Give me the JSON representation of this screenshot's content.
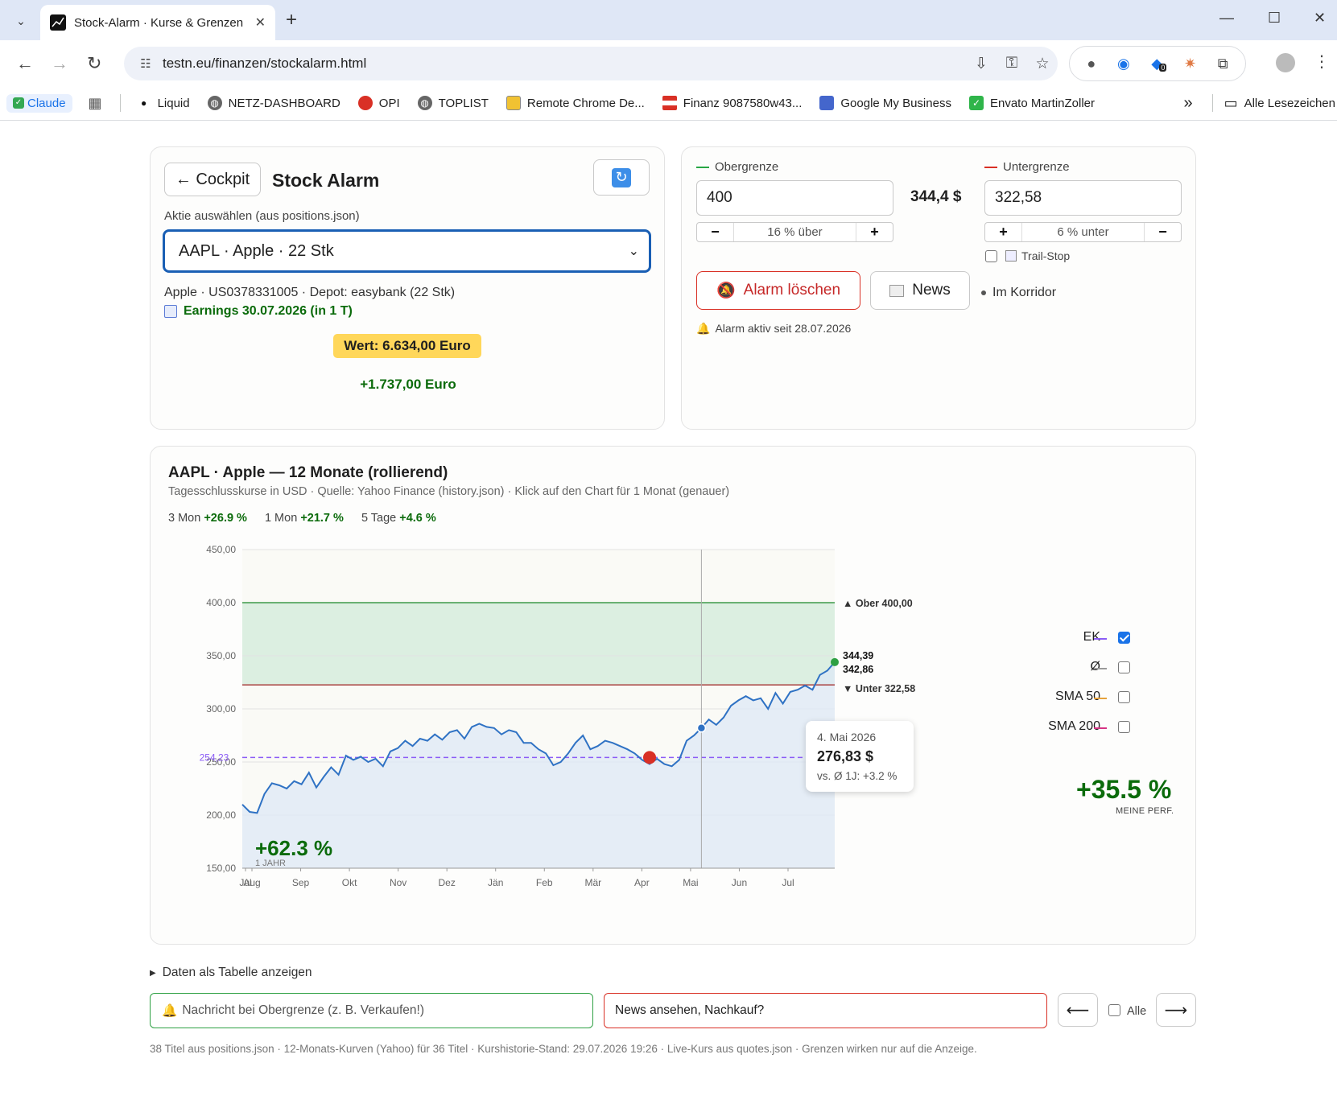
{
  "browser": {
    "tab_title": "Stock-Alarm · Kurse & Grenzen",
    "url": "testn.eu/finanzen/stockalarm.html",
    "extension_badge": "0",
    "bookmarks": [
      "Claude",
      "Liquid",
      "NETZ-DASHBOARD",
      "OPI",
      "TOPLIST",
      "Remote Chrome De...",
      "Finanz 9087580w43...",
      "Google My Business",
      "Envato MartinZoller"
    ],
    "bookmarks_more": "»",
    "all_bookmarks": "Alle Lesezeichen"
  },
  "left_card": {
    "back_label": "← Cockpit",
    "title": "Stock Alarm",
    "select_label": "Aktie auswählen (aus positions.json)",
    "select_value": "AAPL · Apple · 22 Stk",
    "info": "Apple · US0378331005 · Depot: easybank (22 Stk)",
    "earnings": "Earnings 30.07.2026 (in 1 T)",
    "value": "Wert: 6.634,00 Euro",
    "gain": "+1.737,00 Euro"
  },
  "right_card": {
    "upper_label": "Obergrenze",
    "upper_value": "400",
    "current_price": "344,4 $",
    "lower_label": "Untergrenze",
    "lower_value": "322,58",
    "upper_step": {
      "minus": "−",
      "text": "16 % über",
      "plus": "+"
    },
    "lower_step": {
      "plus": "+",
      "text": "6 % unter",
      "minus": "−"
    },
    "trail_stop": "Trail-Stop",
    "delete_alarm": "Alarm löschen",
    "news": "News",
    "status": "Im Korridor",
    "alarm_since": "Alarm aktiv seit 28.07.2026"
  },
  "chart_card": {
    "title": "AAPL · Apple — 12 Monate (rollierend)",
    "subtitle": "Tagesschlusskurse in USD · Quelle: Yahoo Finance (history.json) · Klick auf den Chart für 1 Monat (genauer)",
    "perf": [
      {
        "label": "3 Mon",
        "value": "+26.9 %"
      },
      {
        "label": "1 Mon",
        "value": "+21.7 %"
      },
      {
        "label": "5 Tage",
        "value": "+4.6 %"
      }
    ],
    "year_perf": "+62.3 %",
    "year_label": "1 JAHR",
    "my_perf": "+35.5 %",
    "my_perf_label": "MEINE PERF.",
    "toggles": [
      {
        "label": "EK",
        "color": "#8b5cf6",
        "checked": true
      },
      {
        "label": "Ø",
        "color": "#9a9a9a",
        "checked": false
      },
      {
        "label": "SMA 50",
        "color": "#e6a23c",
        "checked": false
      },
      {
        "label": "SMA 200",
        "color": "#d63384",
        "checked": false
      }
    ],
    "tooltip": {
      "date": "4. Mai 2026",
      "price": "276,83 $",
      "compare": "vs. Ø 1J: +3.2 %"
    }
  },
  "chart_data": {
    "type": "line",
    "ylim": [
      150,
      450
    ],
    "yticks": [
      "450,00",
      "400,00",
      "350,00",
      "300,00",
      "250,00",
      "200,00",
      "150,00"
    ],
    "ytick_values": [
      450,
      400,
      350,
      300,
      250,
      200,
      150
    ],
    "xticks": [
      "Jul",
      "Aug",
      "Sep",
      "Okt",
      "Nov",
      "Dez",
      "Jän",
      "Feb",
      "Mär",
      "Apr",
      "Mai",
      "Jun",
      "Jul"
    ],
    "upper_limit": 400,
    "upper_label": "▲ Ober 400,00",
    "lower_limit": 322.58,
    "lower_label": "▼ Unter 322,58",
    "buy_price": 254.23,
    "buy_label": "● Kauf 254,23",
    "last_labels": [
      "344,39",
      "342,86"
    ],
    "series_values": [
      210,
      203,
      202,
      220,
      230,
      228,
      225,
      232,
      229,
      240,
      226,
      236,
      245,
      238,
      256,
      252,
      255,
      250,
      253,
      246,
      260,
      263,
      270,
      265,
      272,
      270,
      276,
      271,
      278,
      280,
      272,
      283,
      286,
      283,
      282,
      276,
      280,
      278,
      268,
      268,
      262,
      258,
      247,
      250,
      258,
      268,
      275,
      262,
      265,
      270,
      268,
      265,
      262,
      258,
      252,
      248,
      253,
      248,
      246,
      252,
      270,
      275,
      282,
      290,
      285,
      292,
      303,
      308,
      312,
      308,
      310,
      300,
      315,
      305,
      316,
      318,
      322,
      318,
      332,
      336,
      344
    ]
  },
  "footer": {
    "table_toggle": "Daten als Tabelle anzeigen",
    "upper_msg_placeholder": "Nachricht bei Obergrenze (z. B. Verkaufen!)",
    "lower_msg_value": "News ansehen, Nachkauf?",
    "prev": "⟵",
    "all_label": "Alle",
    "next": "⟶",
    "note": "38 Titel aus positions.json · 12-Monats-Kurven (Yahoo) für 36 Titel · Kurshistorie-Stand: 29.07.2026 19:26 · Live-Kurs aus quotes.json · Grenzen wirken nur auf die Anzeige."
  }
}
